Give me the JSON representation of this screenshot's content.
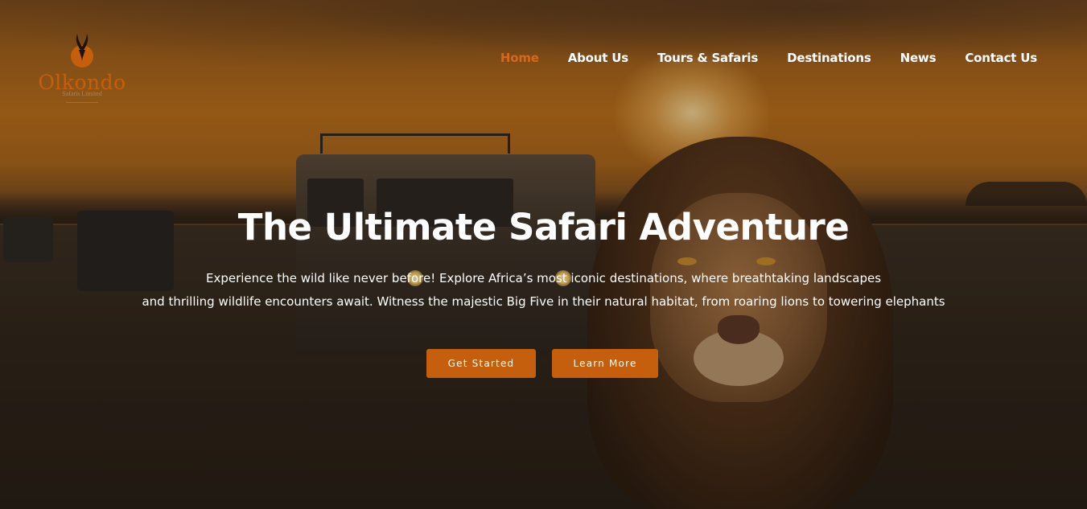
{
  "brand": {
    "name": "Olkondo",
    "tagline": "Safaris Limited",
    "accent_color": "#c55f0d",
    "logo_icon": "antelope-horns-icon"
  },
  "nav": {
    "items": [
      {
        "label": "Home",
        "active": true
      },
      {
        "label": "About Us",
        "active": false
      },
      {
        "label": "Tours & Safaris",
        "active": false
      },
      {
        "label": "Destinations",
        "active": false
      },
      {
        "label": "News",
        "active": false
      },
      {
        "label": "Contact Us",
        "active": false
      }
    ]
  },
  "hero": {
    "title": "The Ultimate Safari Adventure",
    "description_line1": "Experience the wild like never before! Explore Africa’s most iconic destinations, where breathtaking  landscapes",
    "description_line2": "and thrilling wildlife encounters await. Witness the majestic Big Five in their natural habitat, from roaring lions to towering elephants",
    "buttons": {
      "primary_label": "Get Started",
      "secondary_label": "Learn More"
    }
  }
}
